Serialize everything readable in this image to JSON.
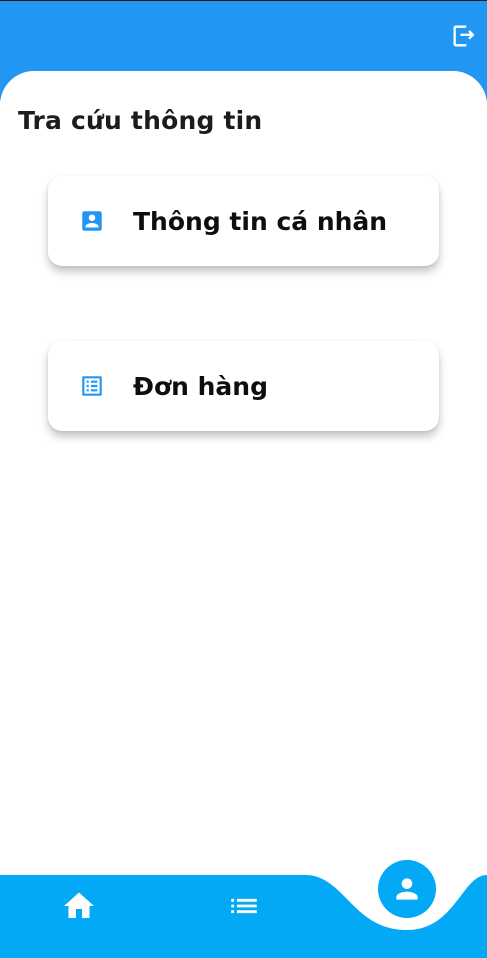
{
  "header": {
    "logout_icon": "logout-icon",
    "background_color": "#2196f3"
  },
  "main": {
    "section_title": "Tra cứu thông tin",
    "cards": [
      {
        "label": "Thông tin cá nhân",
        "icon": "account-box-icon"
      },
      {
        "label": "Đơn hàng",
        "icon": "list-alt-icon"
      }
    ],
    "accent_color": "#2196f3"
  },
  "bottom_nav": {
    "background_color": "#03a9f4",
    "items": [
      {
        "icon": "home-icon"
      },
      {
        "icon": "list-icon"
      },
      {
        "icon": "person-icon",
        "active": true
      }
    ]
  }
}
